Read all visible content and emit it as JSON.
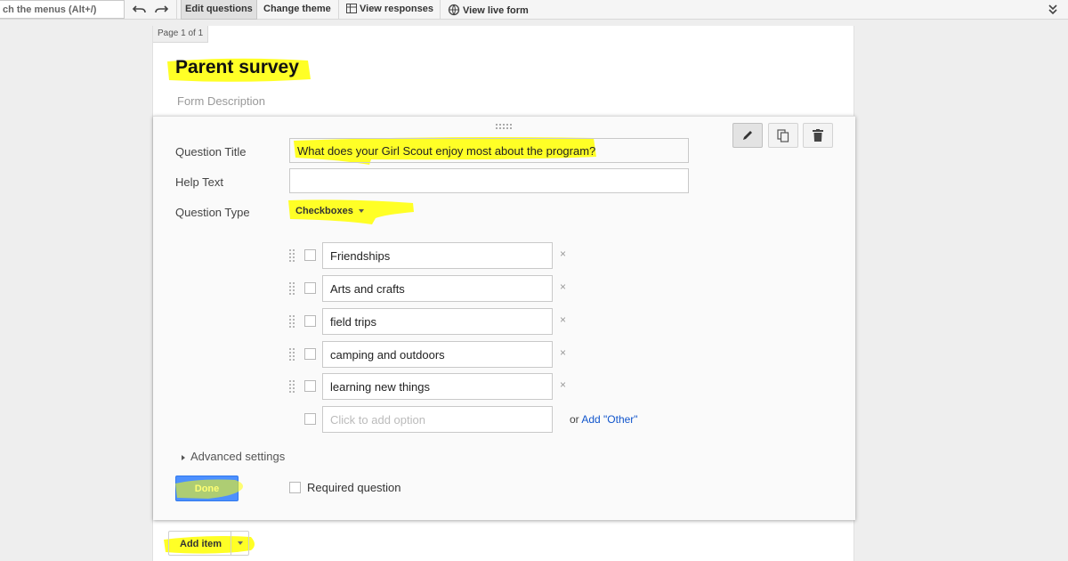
{
  "toolbar": {
    "search_text": "ch the menus (Alt+/)",
    "undo_icon": "undo-icon",
    "redo_icon": "redo-icon",
    "edit_questions": "Edit questions",
    "change_theme": "Change theme",
    "view_responses": "View responses",
    "view_live_form": "View live form",
    "collapse_icon": "double-chevron-down-icon"
  },
  "page": {
    "page_indicator": "Page 1 of 1",
    "title": "Parent survey",
    "description_placeholder": "Form Description"
  },
  "editor": {
    "actions": [
      "edit-icon",
      "duplicate-icon",
      "delete-icon"
    ],
    "question_title_label": "Question Title",
    "question_title_value": "What does your Girl Scout enjoy most about the program?",
    "help_text_label": "Help Text",
    "help_text_value": "",
    "question_type_label": "Question Type",
    "question_type_value": "Checkboxes",
    "options": [
      "Friendships",
      "Arts and crafts",
      "field trips",
      "camping and outdoors",
      "learning new things"
    ],
    "remove_symbol": "×",
    "add_option_placeholder": "Click to add option",
    "or_text": "or",
    "add_other_link": "Add \"Other\"",
    "advanced_settings": "Advanced settings",
    "done_button": "Done",
    "required_question": "Required question",
    "required_checked": false
  },
  "add_item": {
    "label": "Add item"
  },
  "annotation_color": "#ffff00",
  "accent_color": "#4d90fe"
}
